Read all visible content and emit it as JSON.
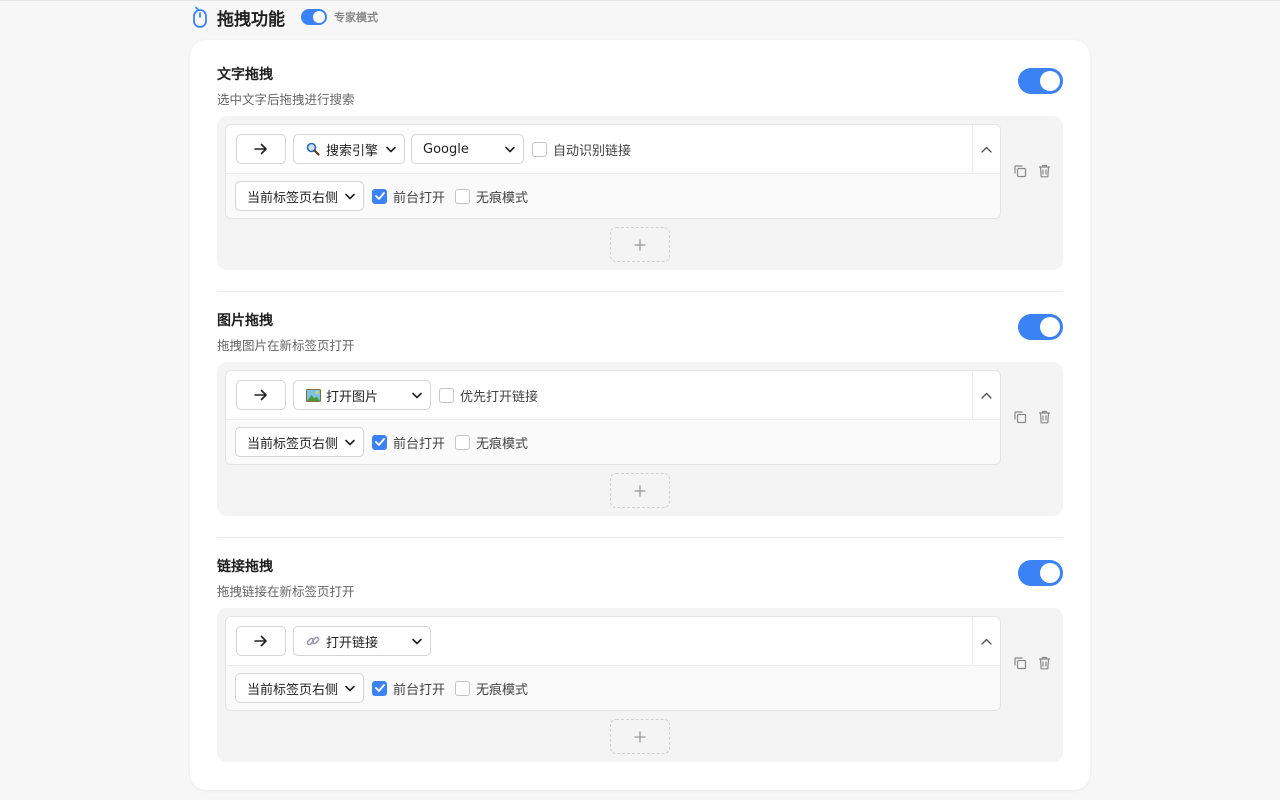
{
  "header": {
    "title": "拖拽功能",
    "mode_label": "专家模式",
    "mode_enabled": true
  },
  "sections": [
    {
      "title": "文字拖拽",
      "description": "选中文字后拖拽进行搜索",
      "enabled": true,
      "rule": {
        "action": "搜索引擎",
        "action_icon": "magnifier-emoji",
        "engine": "Google",
        "option_label": "自动识别链接",
        "option_checked": false,
        "position": "当前标签页右侧",
        "foreground_label": "前台打开",
        "foreground_checked": true,
        "incognito_label": "无痕模式",
        "incognito_checked": false
      }
    },
    {
      "title": "图片拖拽",
      "description": "拖拽图片在新标签页打开",
      "enabled": true,
      "rule": {
        "action": "打开图片",
        "action_icon": "picture-emoji",
        "option_label": "优先打开链接",
        "option_checked": false,
        "position": "当前标签页右侧",
        "foreground_label": "前台打开",
        "foreground_checked": true,
        "incognito_label": "无痕模式",
        "incognito_checked": false
      }
    },
    {
      "title": "链接拖拽",
      "description": "拖拽链接在新标签页打开",
      "enabled": true,
      "rule": {
        "action": "打开链接",
        "action_icon": "link-emoji",
        "position": "当前标签页右侧",
        "foreground_label": "前台打开",
        "foreground_checked": true,
        "incognito_label": "无痕模式",
        "incognito_checked": false
      }
    }
  ],
  "colors": {
    "accent": "#3b82f6",
    "background": "#f7f7f8",
    "rule_box": "#f4f4f5"
  }
}
